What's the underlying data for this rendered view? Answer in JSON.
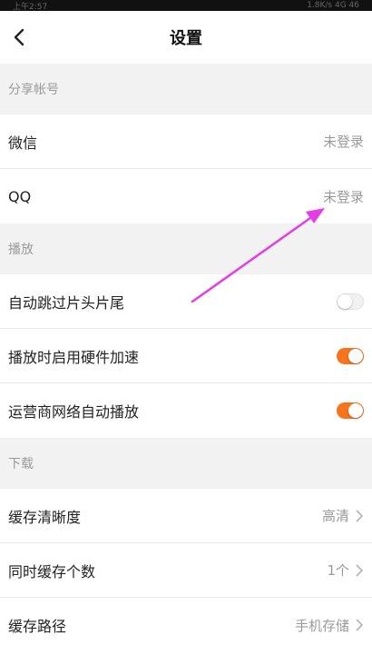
{
  "status_bar": {
    "left": "上午2:57",
    "right": "1.8K/s  4G  46"
  },
  "nav": {
    "title": "设置",
    "back_icon": "chevron-left-icon"
  },
  "sections": {
    "share": {
      "title": "分享帐号",
      "wechat": {
        "label": "微信",
        "value": "未登录"
      },
      "qq": {
        "label": "QQ",
        "value": "未登录"
      }
    },
    "playback": {
      "title": "播放",
      "skip": {
        "label": "自动跳过片头片尾",
        "state": "off"
      },
      "hardware": {
        "label": "播放时启用硬件加速",
        "state": "on"
      },
      "carrier": {
        "label": "运营商网络自动播放",
        "state": "on"
      }
    },
    "download": {
      "title": "下载",
      "quality": {
        "label": "缓存清晰度",
        "value": "高清"
      },
      "concurrent": {
        "label": "同时缓存个数",
        "value": "1个"
      },
      "path": {
        "label": "缓存路径",
        "value": "手机存储"
      }
    }
  },
  "colors": {
    "accent": "#f7731d",
    "annotation": "#e63ce6"
  }
}
